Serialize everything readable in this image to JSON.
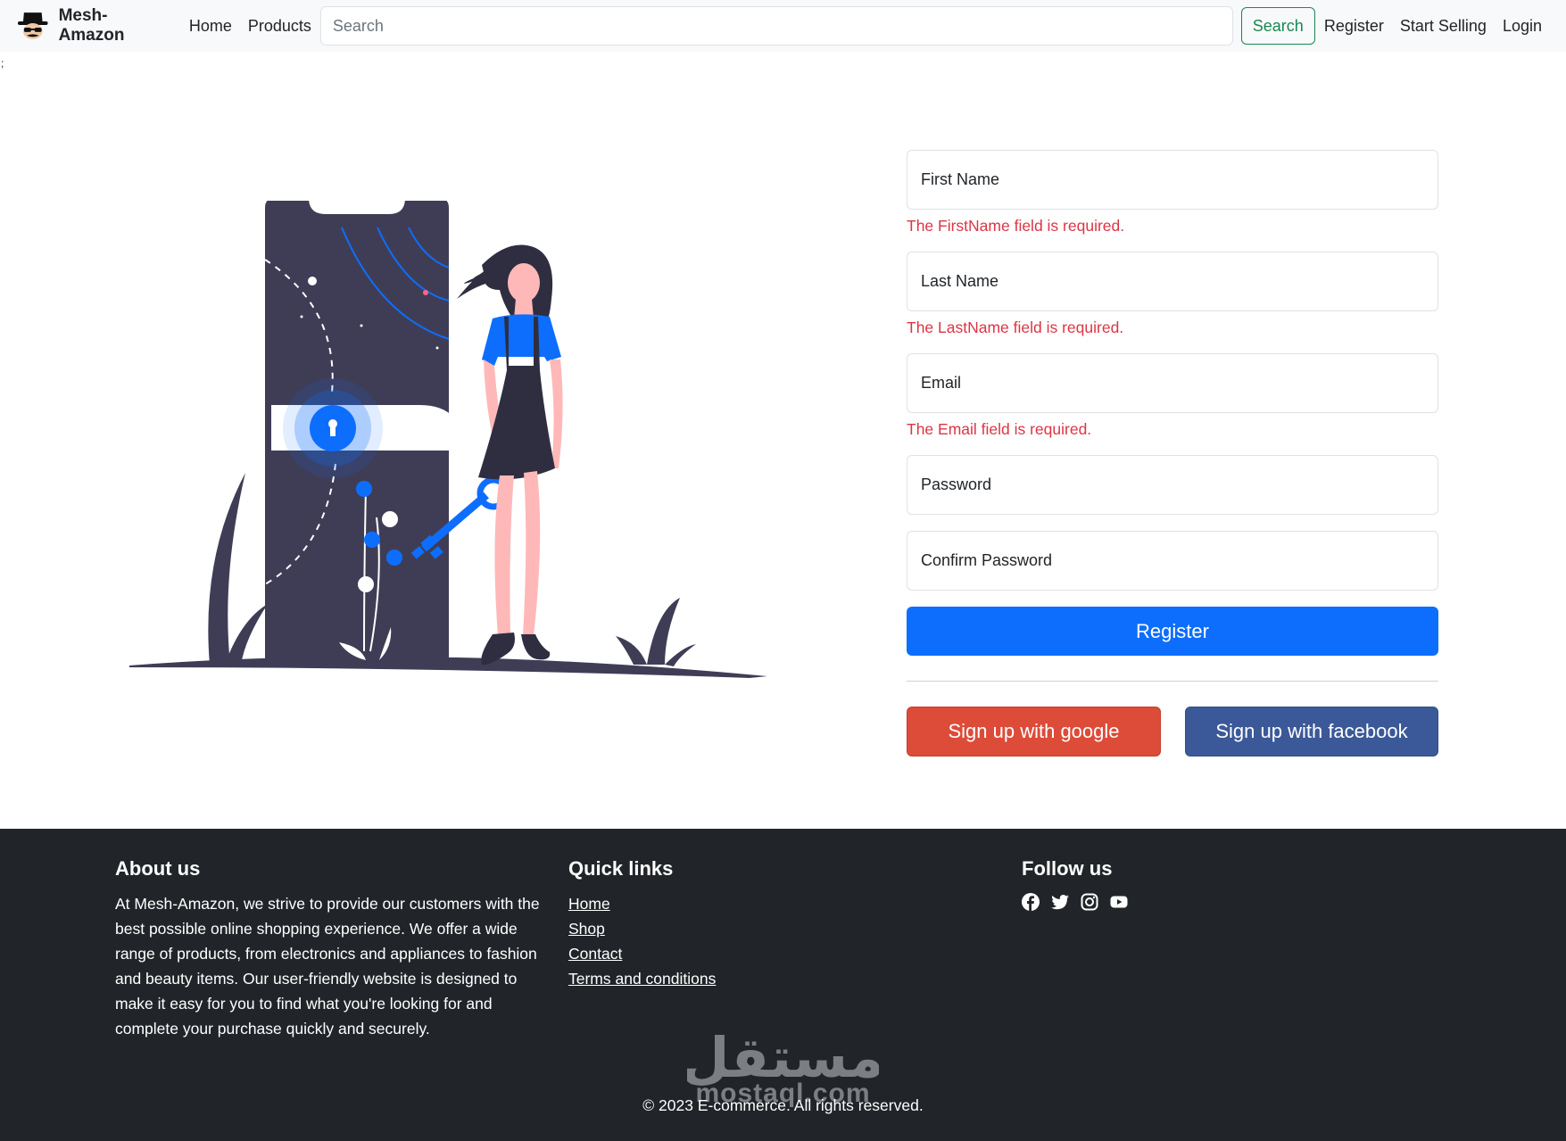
{
  "navbar": {
    "brand": "Mesh-Amazon",
    "links": [
      "Home",
      "Products"
    ],
    "search_placeholder": "Search",
    "search_button": "Search",
    "right_links": [
      "Register",
      "Start Selling",
      "Login"
    ]
  },
  "stray_text": ";",
  "form": {
    "first_name_placeholder": "First Name",
    "first_name_error": "The FirstName field is required.",
    "last_name_placeholder": "Last Name",
    "last_name_error": "The LastName field is required.",
    "email_placeholder": "Email",
    "email_error": "The Email field is required.",
    "password_placeholder": "Password",
    "confirm_password_placeholder": "Confirm Password",
    "register_button": "Register",
    "google_button": "Sign up with google",
    "facebook_button": "Sign up with facebook"
  },
  "footer": {
    "about_title": "About us",
    "about_text": "At Mesh-Amazon, we strive to provide our customers with the best possible online shopping experience. We offer a wide range of products, from electronics and appliances to fashion and beauty items. Our user-friendly website is designed to make it easy for you to find what you're looking for and complete your purchase quickly and securely.",
    "quick_links_title": "Quick links",
    "quick_links": [
      "Home",
      "Shop",
      "Contact",
      "Terms and conditions"
    ],
    "follow_title": "Follow us",
    "social_icons": [
      "facebook-icon",
      "twitter-icon",
      "instagram-icon",
      "youtube-icon"
    ],
    "copyright": "© 2023 E-commerce. All rights reserved."
  },
  "watermark": {
    "arabic": "مستقل",
    "latin": "mostaql.com"
  },
  "colors": {
    "primary": "#0d6efd",
    "success": "#198754",
    "danger": "#dc3545",
    "google": "#dd4b39",
    "facebook": "#3b5998",
    "footer_bg": "#212529",
    "illustration_dark": "#3f3d56"
  }
}
